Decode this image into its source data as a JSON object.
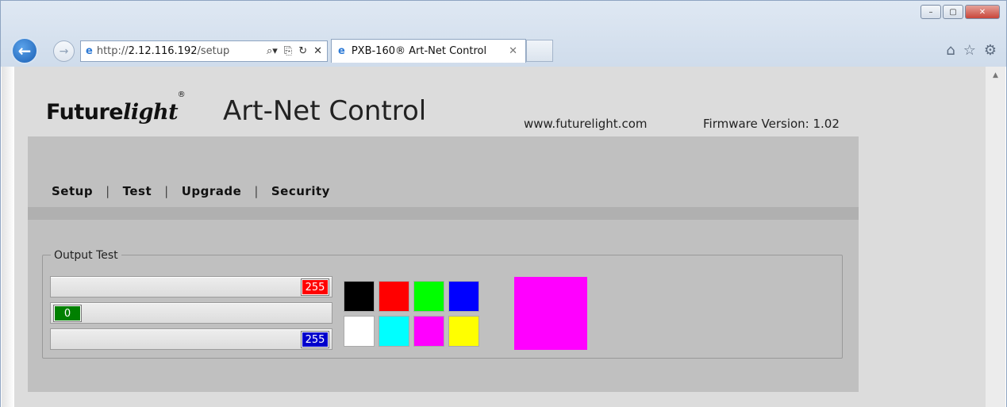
{
  "browser": {
    "address_prefix": "http://",
    "address_host": "2.12.116.192",
    "address_path": "/setup",
    "tab_title": "PXB-160® Art-Net Control",
    "tab_close": "✕",
    "window_buttons": [
      "–",
      "▢",
      "✕"
    ]
  },
  "header": {
    "logo_main": "Future",
    "logo_italic": "light",
    "logo_registered": "®",
    "title": "Art-Net Control",
    "website": "www.futurelight.com",
    "firmware": "Firmware Version: 1.02"
  },
  "menu": {
    "items": [
      "Setup",
      "Test",
      "Upgrade",
      "Security"
    ],
    "separator": "|"
  },
  "output_test": {
    "legend": "Output Test",
    "sliders": [
      {
        "channel": "red",
        "value": "255",
        "fraction": 1.0,
        "color": "#ff0000"
      },
      {
        "channel": "green",
        "value": "0",
        "fraction": 0.0,
        "color": "#008000"
      },
      {
        "channel": "blue",
        "value": "255",
        "fraction": 1.0,
        "color": "#0000cc"
      }
    ],
    "swatches": [
      {
        "name": "black",
        "color": "#000000"
      },
      {
        "name": "red",
        "color": "#ff0000"
      },
      {
        "name": "green",
        "color": "#00ff00"
      },
      {
        "name": "blue",
        "color": "#0000ff"
      },
      {
        "name": "white",
        "color": "#ffffff"
      },
      {
        "name": "cyan",
        "color": "#00ffff"
      },
      {
        "name": "magenta",
        "color": "#ff00ff"
      },
      {
        "name": "yellow",
        "color": "#ffff00"
      }
    ],
    "preview_color": "#ff00ff"
  }
}
